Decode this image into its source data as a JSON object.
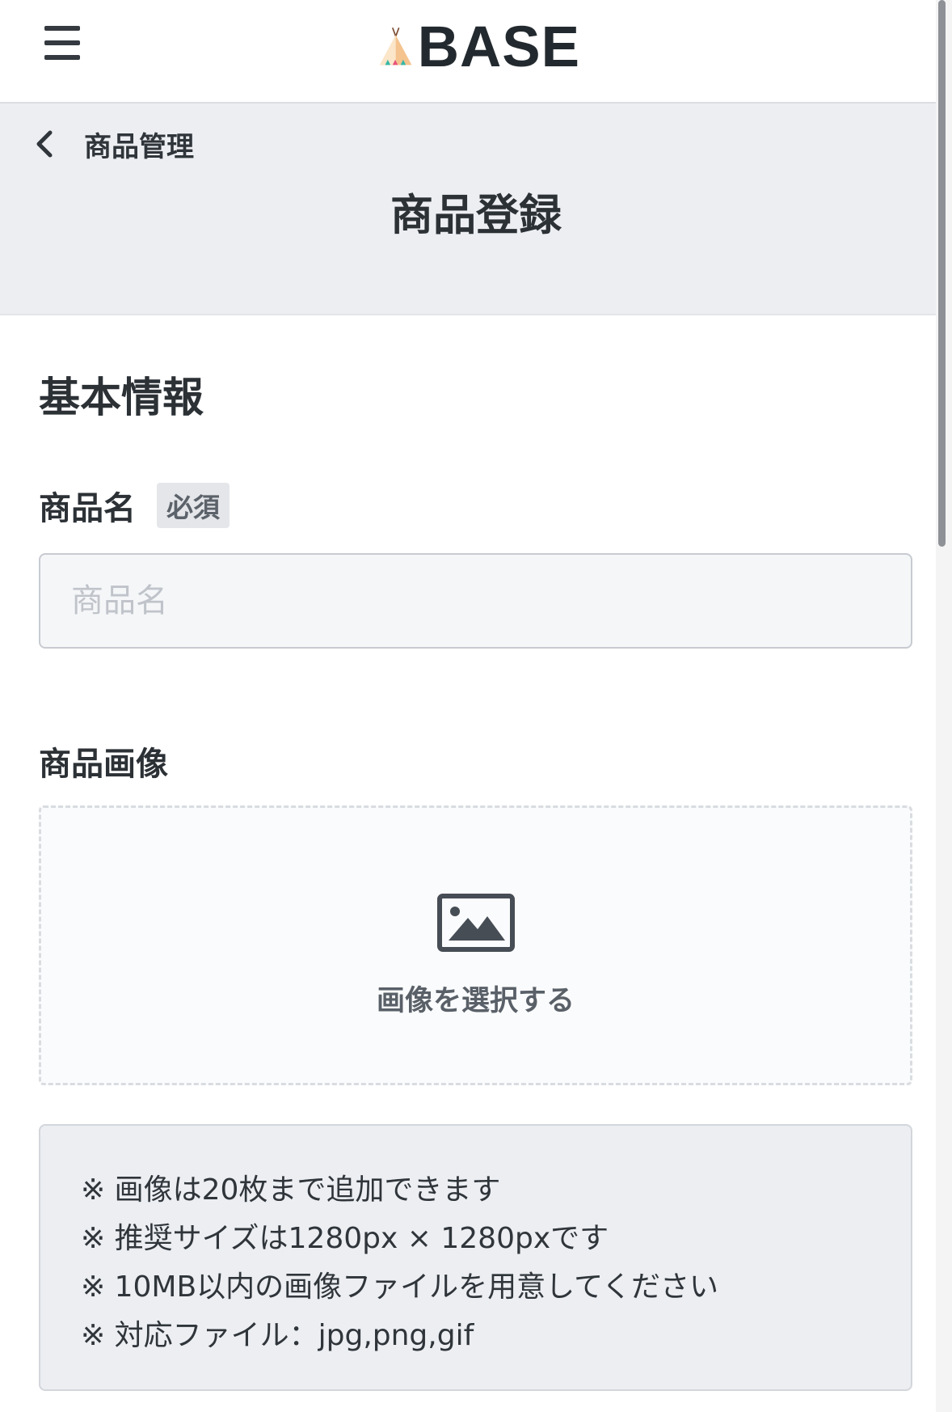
{
  "header": {
    "menu_icon": "hamburger-menu-icon",
    "logo_text": "BASE",
    "logo_icon": "tent-icon",
    "colors": {
      "tent_peach": "#f4c38e",
      "tent_light": "#fbe6c9",
      "tent_pink": "#e8537a",
      "tent_teal": "#36b8a6",
      "pole": "#7a4a30"
    }
  },
  "subheader": {
    "back_icon": "chevron-left-icon",
    "back_label": "商品管理",
    "page_title": "商品登録"
  },
  "form": {
    "section_title": "基本情報",
    "product_name": {
      "label": "商品名",
      "badge": "必須",
      "value": "",
      "placeholder": "商品名"
    },
    "product_image": {
      "label": "商品画像",
      "icon": "image-icon",
      "select_label": "画像を選択する"
    },
    "notes": [
      "※ 画像は20枚まで追加できます",
      "※ 推奨サイズは1280px × 1280pxです",
      "※ 10MB以内の画像ファイルを用意してください",
      "※ 対応ファイル：jpg,png,gif"
    ]
  },
  "colors": {
    "text": "#2c3136",
    "subheader_bg": "#eceef2",
    "input_bg": "#f5f6f8",
    "border": "#c7cbd1"
  }
}
